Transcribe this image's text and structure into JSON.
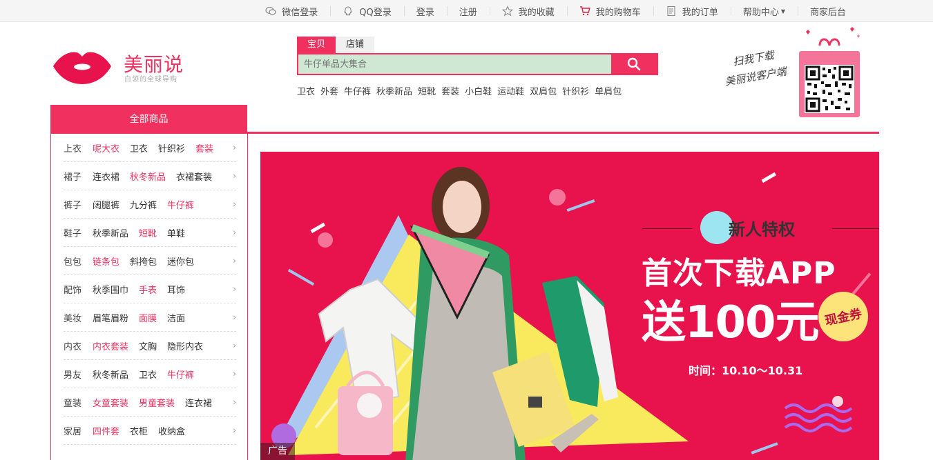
{
  "topbar": {
    "items": [
      {
        "label": "微信登录",
        "icon": "wechat-icon"
      },
      {
        "label": "QQ登录",
        "icon": "qq-icon"
      },
      {
        "label": "登录"
      },
      {
        "label": "注册"
      },
      {
        "label": "我的收藏",
        "icon": "star-icon"
      },
      {
        "label": "我的购物车",
        "icon": "cart-icon"
      },
      {
        "label": "我的订单",
        "icon": "order-icon"
      },
      {
        "label": "帮助中心",
        "dropdown": true
      },
      {
        "label": "商家后台"
      }
    ]
  },
  "logo": {
    "title": "美丽说",
    "subtitle": "白领的全球导购"
  },
  "search": {
    "tabs": [
      "宝贝",
      "店铺"
    ],
    "placeholder": "牛仔单品大集合",
    "hot_words": [
      "卫衣",
      "外套",
      "牛仔裤",
      "秋季新品",
      "短靴",
      "套装",
      "小白鞋",
      "运动鞋",
      "双肩包",
      "针织衫",
      "单肩包"
    ]
  },
  "qr": {
    "line1": "扫我下载",
    "line2": "美丽说客户端"
  },
  "category": {
    "title": "全部商品",
    "rows": [
      {
        "items": [
          "上衣",
          "呢大衣",
          "卫衣",
          "针织衫",
          "套装"
        ],
        "hl": [
          1,
          4
        ]
      },
      {
        "items": [
          "裙子",
          "连衣裙",
          "秋冬新品",
          "衣裙套装"
        ],
        "hl": [
          2
        ]
      },
      {
        "items": [
          "裤子",
          "阔腿裤",
          "九分裤",
          "牛仔裤"
        ],
        "hl": [
          3
        ]
      },
      {
        "items": [
          "鞋子",
          "秋季新品",
          "短靴",
          "单鞋"
        ],
        "hl": [
          2
        ]
      },
      {
        "items": [
          "包包",
          "链条包",
          "斜挎包",
          "迷你包"
        ],
        "hl": [
          1
        ]
      },
      {
        "items": [
          "配饰",
          "秋季围巾",
          "手表",
          "耳饰"
        ],
        "hl": [
          2
        ]
      },
      {
        "items": [
          "美妆",
          "眉笔眉粉",
          "面膜",
          "洁面"
        ],
        "hl": [
          2
        ]
      },
      {
        "items": [
          "内衣",
          "内衣套装",
          "文胸",
          "隐形内衣"
        ],
        "hl": [
          1
        ]
      },
      {
        "items": [
          "男友",
          "秋冬新品",
          "卫衣",
          "牛仔裤"
        ],
        "hl": [
          3
        ]
      },
      {
        "items": [
          "童装",
          "女童套装",
          "男童套装",
          "连衣裙"
        ],
        "hl": [
          1,
          2
        ]
      },
      {
        "items": [
          "家居",
          "四件套",
          "衣柜",
          "收纳盒"
        ],
        "hl": [
          1
        ]
      }
    ]
  },
  "banner": {
    "badge": "新人特权",
    "headline": "首次下载APP",
    "offer": "送100元",
    "coupon": "现金券",
    "time": "时间：10.10～10.31",
    "ad_tag": "广告"
  },
  "colors": {
    "brand": "#f0315f",
    "banner_bg": "#e8124c",
    "search_bg": "#cfe8d3"
  }
}
